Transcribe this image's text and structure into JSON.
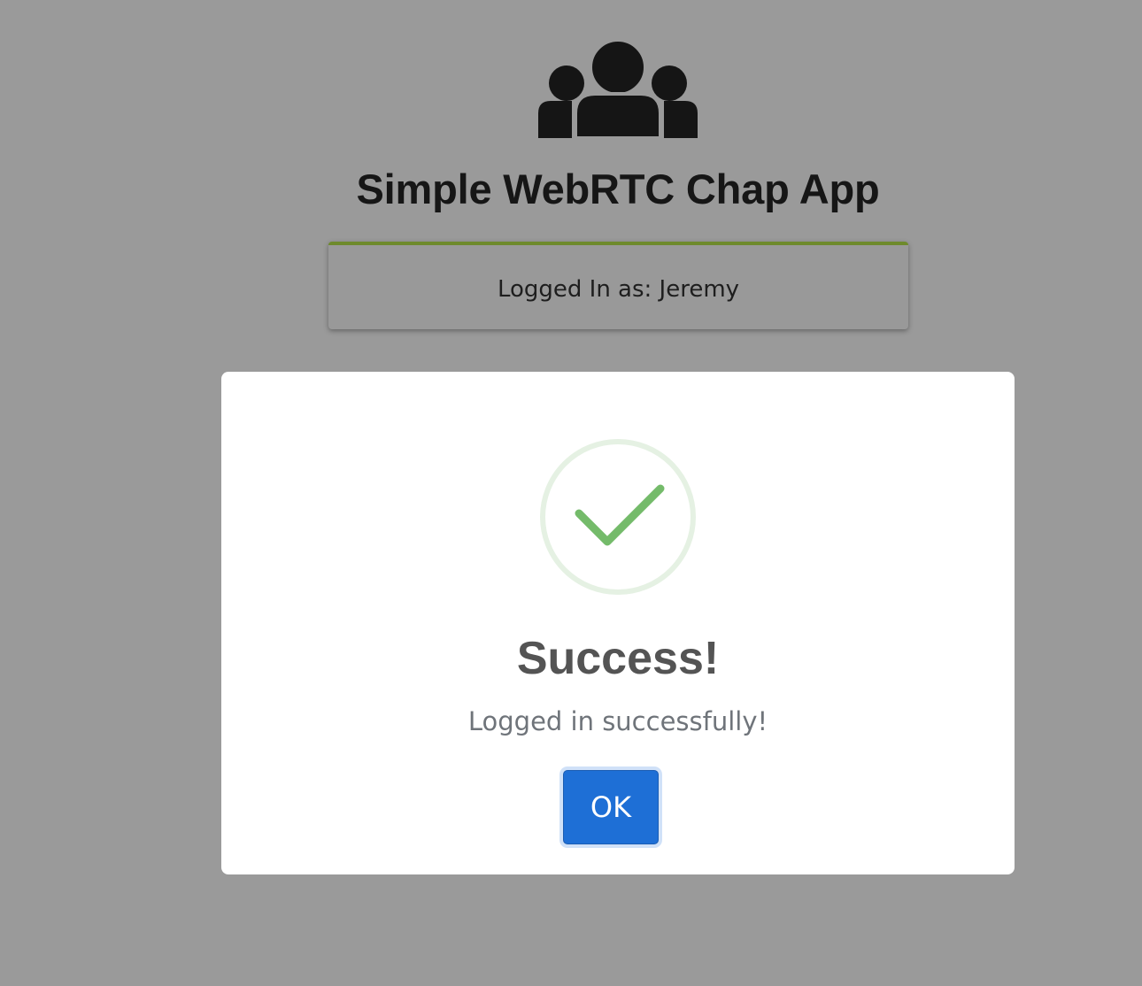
{
  "app": {
    "icon": "users-group-icon",
    "title": "Simple WebRTC Chap App"
  },
  "login_card": {
    "text": "Logged In as: Jeremy",
    "accent_color": "#6e8a2c"
  },
  "modal": {
    "icon": "success-check-icon",
    "title": "Success!",
    "message": "Logged in successfully!",
    "ok_label": "OK",
    "check_color": "#74bb6a",
    "button_color": "#1e6fd6"
  },
  "overlay_color": "#9a9a9a"
}
